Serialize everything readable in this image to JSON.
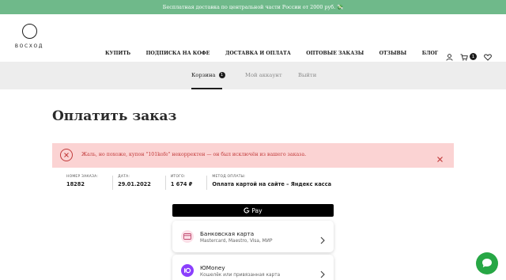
{
  "promo": {
    "text": "Бесплатная доставка по центральной части России от 2000 руб. 💸"
  },
  "header": {
    "logo_text": "ВОСХОД",
    "nav": [
      "КУПИТЬ",
      "ПОДПИСКА НА КОФЕ",
      "ДОСТАВКА И ОПЛАТА",
      "ОПТОВЫЕ ЗАКАЗЫ",
      "ОТЗЫВЫ",
      "БЛОГ"
    ],
    "cart_count": "1"
  },
  "tabs": {
    "items": [
      {
        "label": "Корзина",
        "badge": "1",
        "active": true
      },
      {
        "label": "Мой аккаунт"
      },
      {
        "label": "Выйти"
      }
    ]
  },
  "page": {
    "title": "Оплатить заказ"
  },
  "error": {
    "message": "Жаль, но похоже, купон \"101kofe\" некорректен — он был исключён из вашего заказа."
  },
  "order": {
    "number_label": "НОМЕР ЗАКАЗА:",
    "number": "18282",
    "date_label": "ДАТА:",
    "date": "29.01.2022",
    "total_label": "ИТОГО:",
    "total": "1 674 ₽",
    "method_label": "МЕТОД ОПЛАТЫ:",
    "method": "Оплата картой на сайте – Яндекс касса"
  },
  "payment": {
    "gpay_label": "Pay",
    "options": [
      {
        "title": "Банковская карта",
        "subtitle": "Mastercard, Maestro, Visa, МИР",
        "icon": "card-icon"
      },
      {
        "title": "ЮMoney",
        "subtitle": "Кошелёк или привязанная карта",
        "icon": "yoomoney-icon"
      }
    ]
  },
  "colors": {
    "promo": "#6fb98a",
    "error_bg": "#fbd3d3",
    "error_text": "#c23b3b",
    "chat": "#27a745",
    "yoomoney": "#8b3ffd"
  }
}
